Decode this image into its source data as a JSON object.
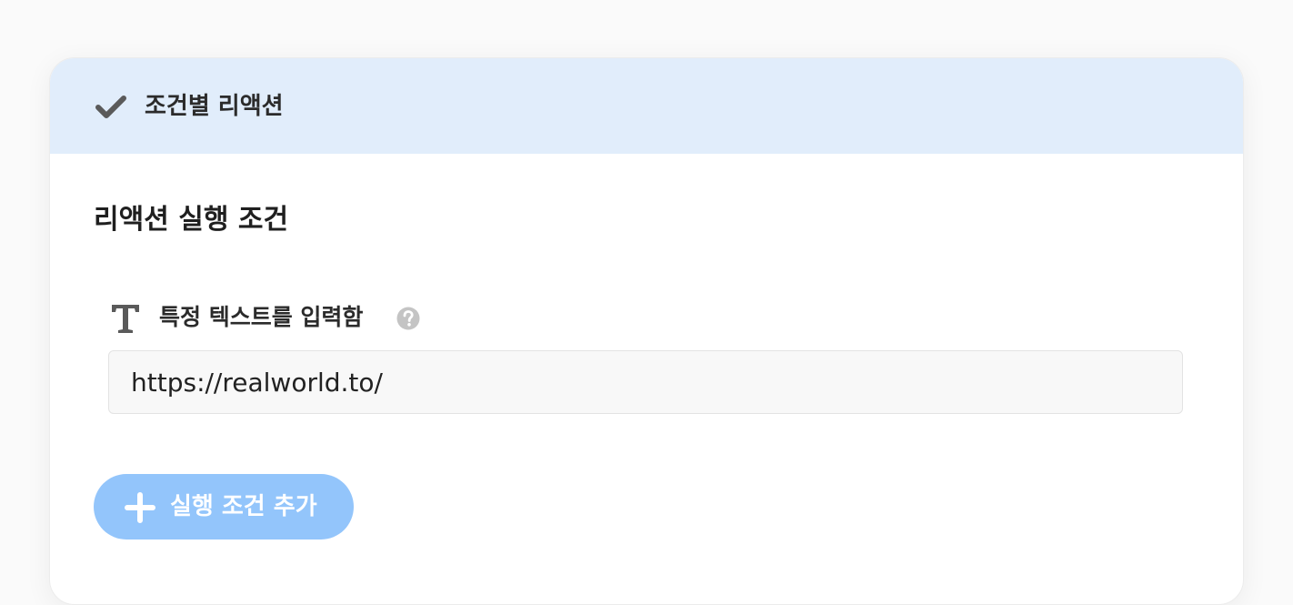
{
  "header": {
    "icon": "checkmark-icon",
    "title": "조건별 리액션"
  },
  "section": {
    "title": "리액션 실행 조건"
  },
  "condition": {
    "icon": "text-type-icon",
    "label": "특정 텍스트를 입력함",
    "help_icon": "question-circle-icon",
    "input_value": "https://realworld.to/"
  },
  "add_button": {
    "icon": "plus-icon",
    "label": "실행 조건 추가"
  },
  "colors": {
    "header_background": "#e1edfb",
    "button_background": "#93c5fb",
    "icon_gray": "#5a5a5a",
    "help_gray": "#c4c4c4"
  }
}
